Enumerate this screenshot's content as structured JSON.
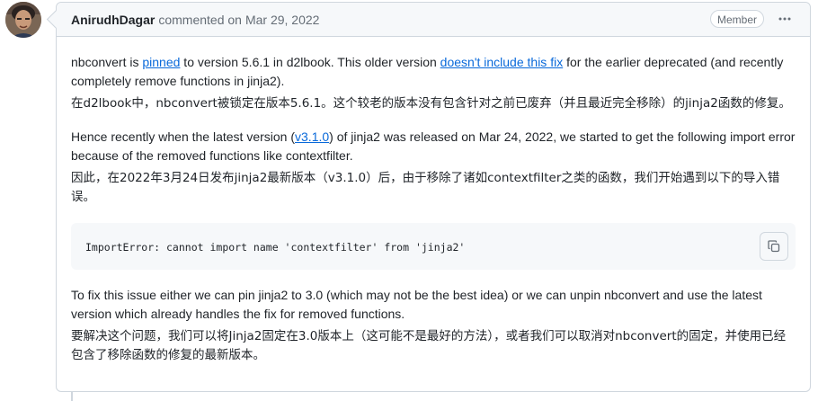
{
  "comment": {
    "author": "AnirudhDagar",
    "action": "commented on",
    "date": "Mar 29, 2022",
    "badge": "Member",
    "paragraph1": {
      "t1": "nbconvert is ",
      "link1": "pinned",
      "t2": " to version 5.6.1 in d2lbook. This older version ",
      "link2": "doesn't include this fix",
      "t3": " for the earlier deprecated (and recently completely remove functions in jinja2).",
      "cn": "在d2lbook中，nbconvert被锁定在版本5.6.1。这个较老的版本没有包含针对之前已废弃（并且最近完全移除）的jinja2函数的修复。"
    },
    "paragraph2": {
      "t1": "Hence recently when the latest version (",
      "link1": "v3.1.0",
      "t2": ") of jinja2 was released on Mar 24, 2022, we started to get the following import error because of the removed functions like contextfilter.",
      "cn": "因此，在2022年3月24日发布jinja2最新版本（v3.1.0）后，由于移除了诸如contextfilter之类的函数，我们开始遇到以下的导入错误。"
    },
    "code": "ImportError: cannot import name 'contextfilter' from 'jinja2'",
    "paragraph3": {
      "text": "To fix this issue either we can pin jinja2 to 3.0 (which may not be the best idea) or we can unpin nbconvert and use the latest version which already handles the fix for removed functions.",
      "cn": "要解决这个问题，我们可以将Jinja2固定在3.0版本上（这可能不是最好的方法），或者我们可以取消对nbconvert的固定，并使用已经包含了移除函数的修复的最新版本。"
    }
  },
  "icons": {
    "avatar": "user-avatar",
    "kebab": "kebab-horizontal-icon",
    "copy": "copy-icon"
  }
}
